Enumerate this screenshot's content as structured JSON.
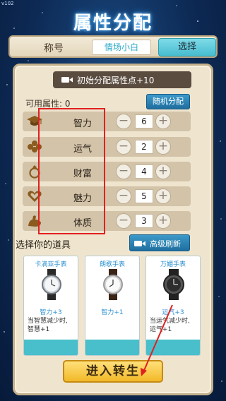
{
  "version": "v102",
  "title": "属性分配",
  "title_bar": {
    "label": "称号",
    "value": "情场小白",
    "select_label": "选择"
  },
  "init_points_button": "初始分配属性点+10",
  "available_label": "可用属性: 0",
  "random_button": "随机分配",
  "attributes": [
    {
      "name": "智力",
      "value": "6",
      "icon": "graduation-cap-icon"
    },
    {
      "name": "运气",
      "value": "2",
      "icon": "clover-icon"
    },
    {
      "name": "财富",
      "value": "4",
      "icon": "ring-icon"
    },
    {
      "name": "魅力",
      "value": "5",
      "icon": "heart-icon"
    },
    {
      "name": "体质",
      "value": "3",
      "icon": "muscle-icon"
    }
  ],
  "minus_symbol": "−",
  "plus_symbol": "+",
  "items_label": "选择你的道具",
  "advanced_refresh_button": "高级刷新",
  "items": [
    {
      "name": "卡滴亚手表",
      "bonus": "智力+3",
      "desc": "当智慧减少时, 智慧+1"
    },
    {
      "name": "朗歌手表",
      "bonus": "智力+1",
      "desc": ""
    },
    {
      "name": "万媚手表",
      "bonus": "运气+3",
      "desc": "当运气减少时, 运气+1"
    }
  ],
  "enter_button": "进入转生",
  "colors": {
    "accent_blue": "#1f6f9f",
    "teal": "#49bfcb",
    "gold": "#f2b928",
    "highlight_red": "#e02020"
  }
}
